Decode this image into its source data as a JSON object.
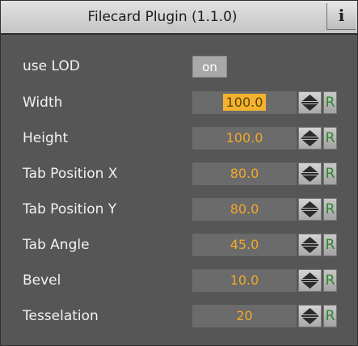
{
  "panel": {
    "title": "Filecard Plugin (1.1.0)",
    "info_label": "i"
  },
  "fields": {
    "use_lod": {
      "label": "use LOD",
      "value": "on"
    },
    "width": {
      "label": "Width",
      "value": "100.0",
      "reset": "R"
    },
    "height": {
      "label": "Height",
      "value": "100.0",
      "reset": "R"
    },
    "tab_position_x": {
      "label": "Tab Position X",
      "value": "80.0",
      "reset": "R"
    },
    "tab_position_y": {
      "label": "Tab Position Y",
      "value": "80.0",
      "reset": "R"
    },
    "tab_angle": {
      "label": "Tab Angle",
      "value": "45.0",
      "reset": "R"
    },
    "bevel": {
      "label": "Bevel",
      "value": "10.0",
      "reset": "R"
    },
    "tesselation": {
      "label": "Tesselation",
      "value": "20",
      "reset": "R"
    }
  },
  "colors": {
    "panel_bg": "#565656",
    "value_text": "#f3a928",
    "reset_text": "#2c8a2c"
  },
  "icons": {
    "stepper": "up-down-arrows-icon",
    "info": "info-icon"
  }
}
